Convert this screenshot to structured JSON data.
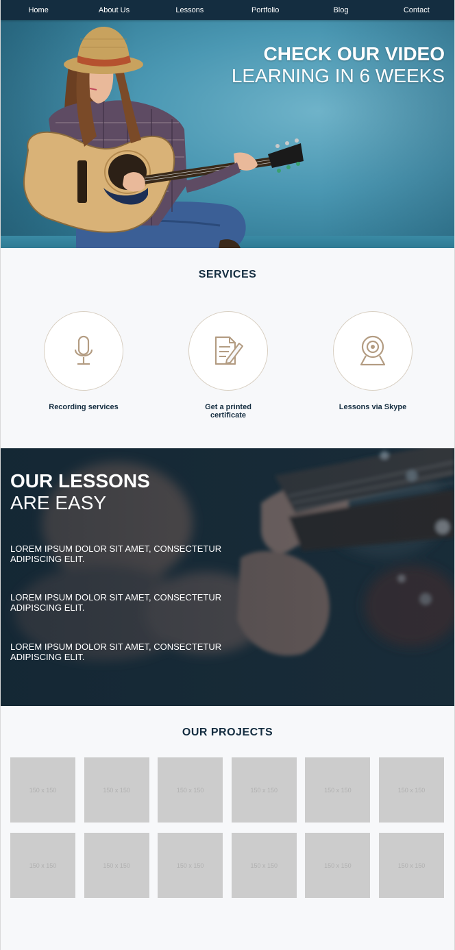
{
  "nav": {
    "items": [
      "Home",
      "About Us",
      "Lessons",
      "Portfolio",
      "Blog",
      "Contact"
    ]
  },
  "hero": {
    "title_line1": "CHECK OUR VIDEO",
    "title_line2": "LEARNING IN 6 WEEKS"
  },
  "services": {
    "title": "SERVICES",
    "items": [
      {
        "label": "Recording services",
        "icon": "microphone-icon"
      },
      {
        "label": "Get a printed certificate",
        "icon": "certificate-icon"
      },
      {
        "label": "Lessons via Skype",
        "icon": "webcam-icon"
      }
    ]
  },
  "lessons": {
    "title_line1": "OUR LESSONS",
    "title_line2": "ARE EASY",
    "points": [
      "LOREM IPSUM DOLOR SIT AMET, CONSECTETUR ADIPISCING ELIT.",
      "LOREM IPSUM DOLOR SIT AMET, CONSECTETUR ADIPISCING ELIT.",
      "LOREM IPSUM DOLOR SIT AMET, CONSECTETUR ADIPISCING ELIT."
    ]
  },
  "projects": {
    "title": "OUR PROJECTS",
    "thumbs": [
      "150 x 150",
      "150 x 150",
      "150 x 150",
      "150 x 150",
      "150 x 150",
      "150 x 150",
      "150 x 150",
      "150 x 150",
      "150 x 150",
      "150 x 150",
      "150 x 150",
      "150 x 150"
    ]
  },
  "colors": {
    "nav_bg": "#142d40",
    "heading": "#142d40",
    "icon_tan": "#b39c82",
    "placeholder": "#cccccc"
  }
}
